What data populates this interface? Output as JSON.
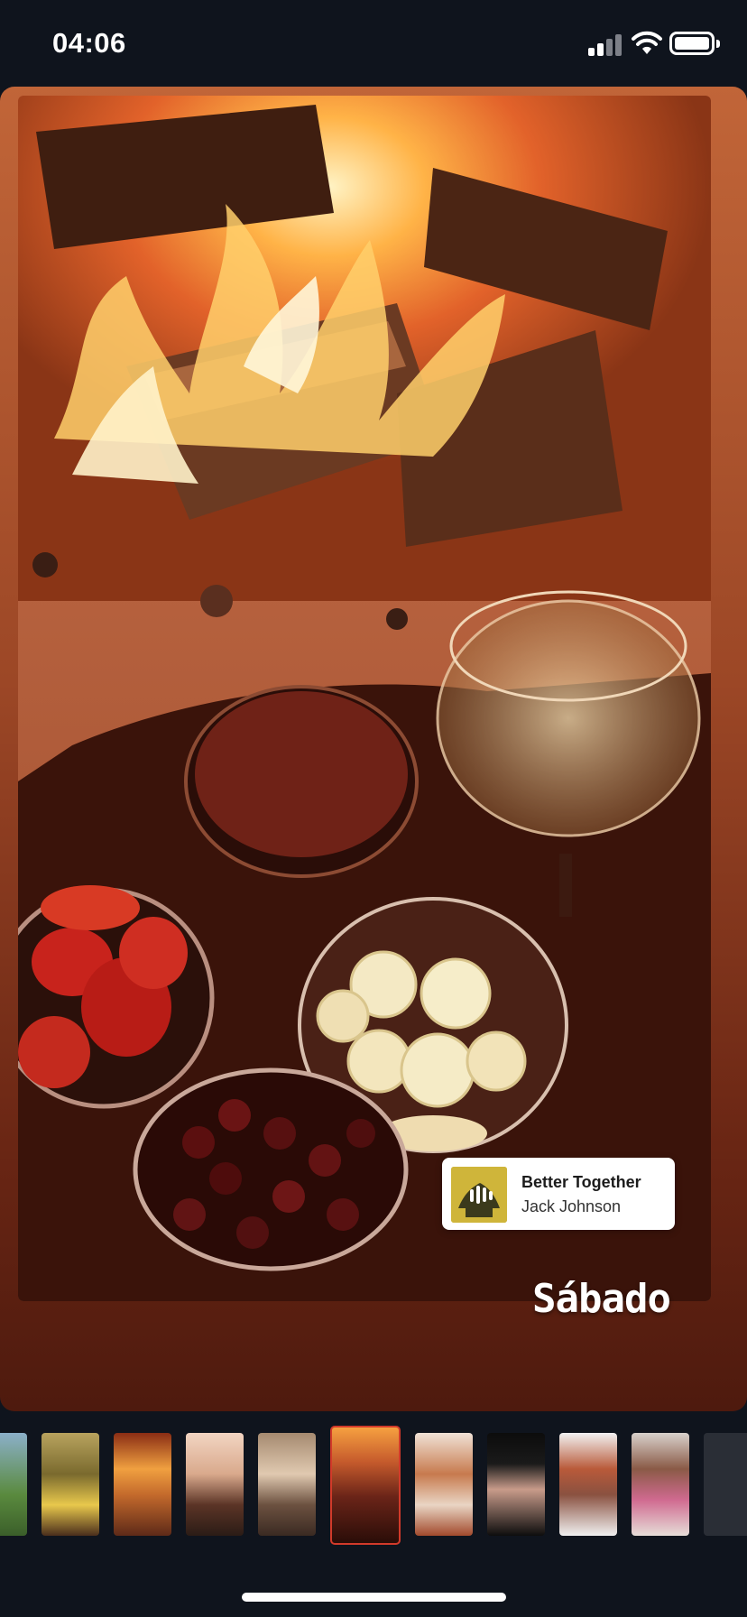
{
  "status_bar": {
    "time": "04:06",
    "icons": [
      "cellular-signal-icon",
      "wifi-icon",
      "battery-icon"
    ]
  },
  "story": {
    "music_sticker": {
      "title": "Better Together",
      "artist": "Jack Johnson"
    },
    "caption": "Sábado"
  },
  "thumbnails": {
    "count": 11,
    "active_index": 5
  },
  "colors": {
    "background": "#0f141d",
    "card_gradient_top": "#c16538",
    "card_gradient_bottom": "#4e1a0e",
    "active_thumb_border": "#d23a2a",
    "album_art": "#cfb53a"
  }
}
